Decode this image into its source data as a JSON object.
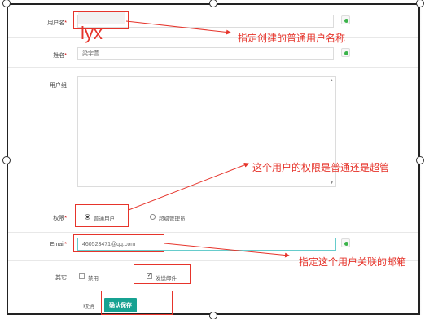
{
  "form": {
    "username": {
      "label": "用户名",
      "required_mark": "*",
      "value": "lyx"
    },
    "name": {
      "label": "姓名",
      "required_mark": "*",
      "value": "梁宇萱"
    },
    "group": {
      "label": "用户组"
    },
    "permission": {
      "label": "权限",
      "required_mark": "*",
      "options": [
        "普通用户",
        "超级管理员"
      ],
      "selected": "普通用户"
    },
    "email": {
      "label": "Email",
      "required_mark": "*",
      "value": "460523471@qq.com"
    },
    "other": {
      "label": "其它",
      "options": [
        {
          "label": "禁用",
          "checked": false
        },
        {
          "label": "发送邮件",
          "checked": true
        }
      ]
    },
    "actions": {
      "cancel": "取消",
      "save": "确认保存"
    }
  },
  "annotations": {
    "username_note": "指定创建的普通用户名称",
    "permission_note": "这个用户的权限是普通还是超管",
    "email_note": "指定这个用户关联的邮箱"
  },
  "colors": {
    "annotation": "#e6342b",
    "save_button": "#17a292",
    "add_icon": "#3bb34a"
  },
  "icons": {
    "add": "green-dot-add-icon"
  }
}
